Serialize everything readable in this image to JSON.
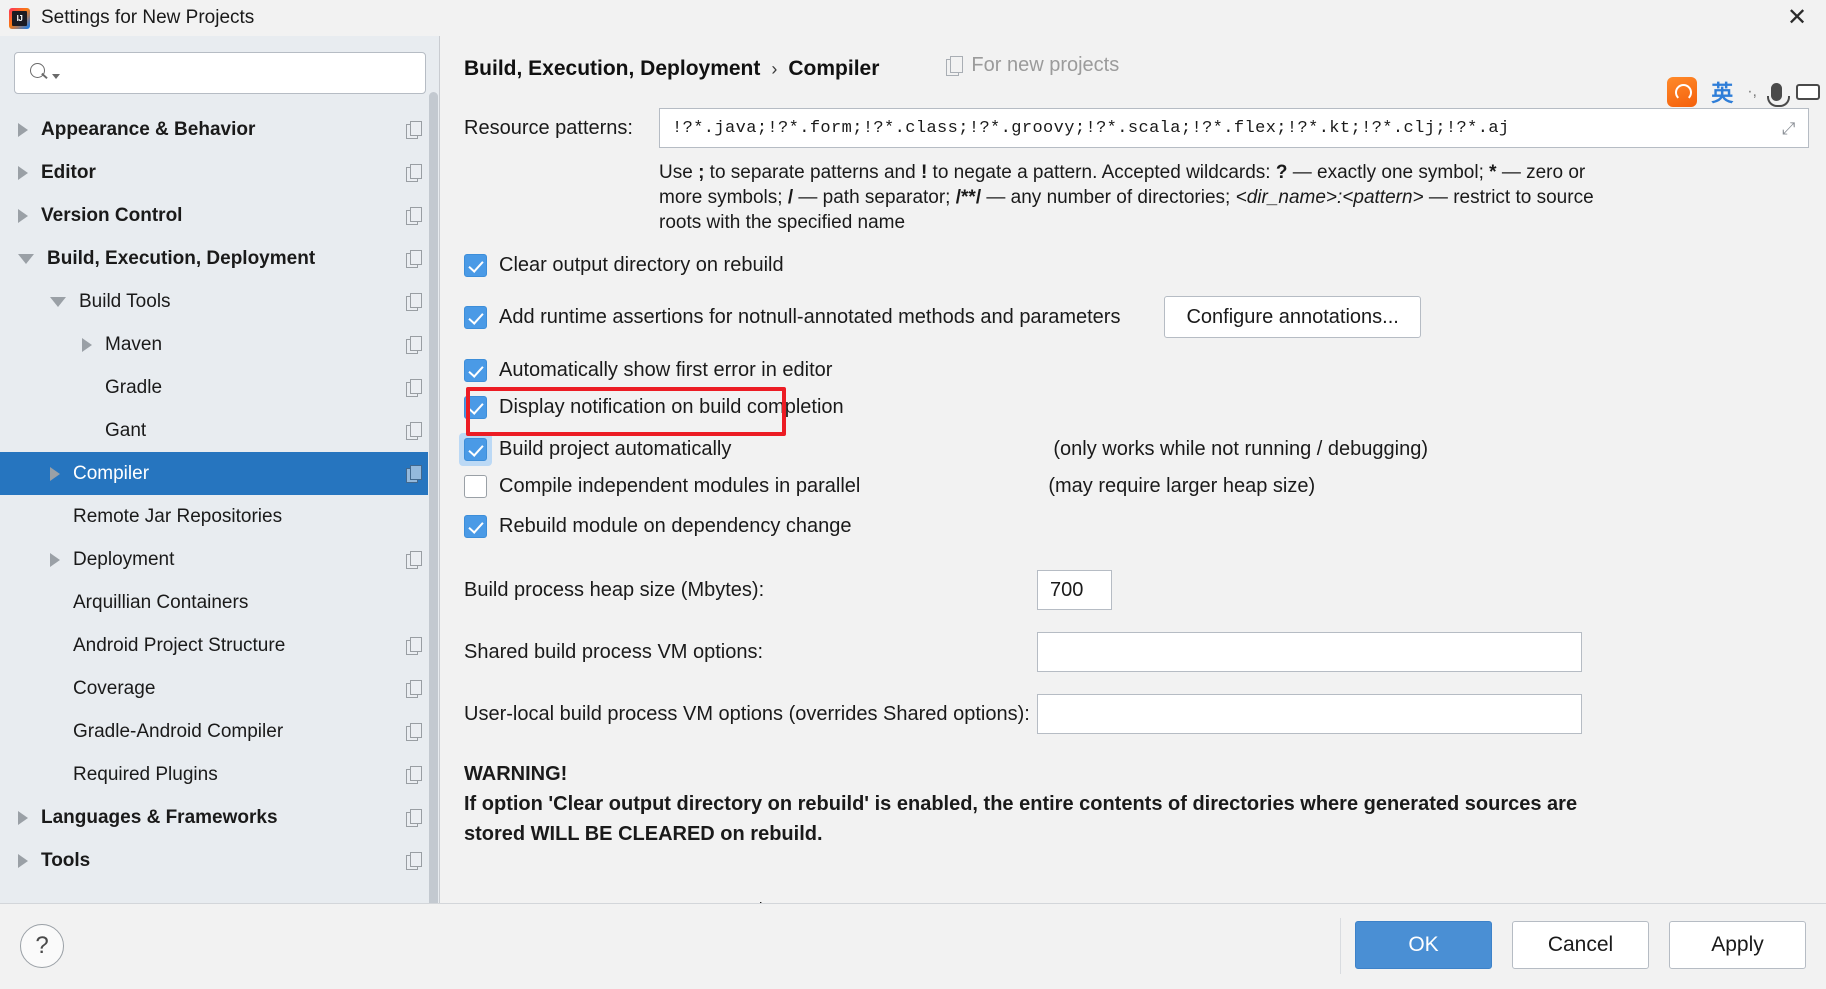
{
  "window": {
    "title": "Settings for New Projects",
    "app_icon": "intellij-idea-logo",
    "close_label": "✕"
  },
  "search": {
    "placeholder": "",
    "value": "",
    "icon": "search-icon"
  },
  "sidebar": {
    "items": [
      {
        "label": "Appearance & Behavior",
        "arrow": "right",
        "indent": 0,
        "bold": true,
        "selected": false,
        "badge": true
      },
      {
        "label": "Editor",
        "arrow": "right",
        "indent": 0,
        "bold": true,
        "selected": false,
        "badge": true
      },
      {
        "label": "Version Control",
        "arrow": "right",
        "indent": 0,
        "bold": true,
        "selected": false,
        "badge": true
      },
      {
        "label": "Build, Execution, Deployment",
        "arrow": "down",
        "indent": 0,
        "bold": true,
        "selected": false,
        "badge": true
      },
      {
        "label": "Build Tools",
        "arrow": "down",
        "indent": 1,
        "bold": false,
        "selected": false,
        "badge": true
      },
      {
        "label": "Maven",
        "arrow": "right",
        "indent": 2,
        "bold": false,
        "selected": false,
        "badge": true
      },
      {
        "label": "Gradle",
        "arrow": "none",
        "indent": 2,
        "bold": false,
        "selected": false,
        "badge": true
      },
      {
        "label": "Gant",
        "arrow": "none",
        "indent": 2,
        "bold": false,
        "selected": false,
        "badge": true
      },
      {
        "label": "Compiler",
        "arrow": "right",
        "indent": 1,
        "bold": false,
        "selected": true,
        "badge": true
      },
      {
        "label": "Remote Jar Repositories",
        "arrow": "none",
        "indent": 1,
        "bold": false,
        "selected": false,
        "badge": false
      },
      {
        "label": "Deployment",
        "arrow": "right",
        "indent": 1,
        "bold": false,
        "selected": false,
        "badge": true
      },
      {
        "label": "Arquillian Containers",
        "arrow": "none",
        "indent": 1,
        "bold": false,
        "selected": false,
        "badge": false
      },
      {
        "label": "Android Project Structure",
        "arrow": "none",
        "indent": 1,
        "bold": false,
        "selected": false,
        "badge": true
      },
      {
        "label": "Coverage",
        "arrow": "none",
        "indent": 1,
        "bold": false,
        "selected": false,
        "badge": true
      },
      {
        "label": "Gradle-Android Compiler",
        "arrow": "none",
        "indent": 1,
        "bold": false,
        "selected": false,
        "badge": true
      },
      {
        "label": "Required Plugins",
        "arrow": "none",
        "indent": 1,
        "bold": false,
        "selected": false,
        "badge": true
      },
      {
        "label": "Languages & Frameworks",
        "arrow": "right",
        "indent": 0,
        "bold": true,
        "selected": false,
        "badge": true
      },
      {
        "label": "Tools",
        "arrow": "right",
        "indent": 0,
        "bold": true,
        "selected": false,
        "badge": true
      }
    ]
  },
  "breadcrumb": {
    "root": "Build, Execution, Deployment",
    "separator": "›",
    "leaf": "Compiler",
    "scope_note": "For new projects",
    "scope_icon": "copy-icon"
  },
  "ime": {
    "logo": "sogou-logo",
    "lang_label": "英",
    "dot_label": "·,",
    "mic_icon": "microphone-icon",
    "keyboard_icon": "keyboard-icon"
  },
  "main": {
    "resource_patterns_label": "Resource patterns:",
    "resource_patterns_value": "!?*.java;!?*.form;!?*.class;!?*.groovy;!?*.scala;!?*.flex;!?*.kt;!?*.clj;!?*.aj",
    "expand_icon": "expand-arrows-icon",
    "help_line_1a": "Use ",
    "help_line_1b": ";",
    "help_line_1c": " to separate patterns and ",
    "help_line_1d": "!",
    "help_line_1e": " to negate a pattern. Accepted wildcards: ",
    "help_line_1f": "?",
    "help_line_1g": " — exactly one symbol; ",
    "help_line_1h": "*",
    "help_line_1i": " — zero or",
    "help_line_2a": "more symbols; ",
    "help_line_2b": "/",
    "help_line_2c": " — path separator; ",
    "help_line_2d": "/**/",
    "help_line_2e": " — any number of directories; ",
    "help_line_2f": "<dir_name>:<pattern>",
    "help_line_2g": " — restrict to",
    "help_line_3": "source roots with the specified name",
    "checkboxes": [
      {
        "label": "Clear output directory on rebuild",
        "checked": true,
        "note": ""
      },
      {
        "label": "Add runtime assertions for notnull-annotated methods and parameters",
        "checked": true,
        "note": ""
      },
      {
        "label": "Automatically show first error in editor",
        "checked": true,
        "note": ""
      },
      {
        "label": "Display notification on build completion",
        "checked": true,
        "note": ""
      },
      {
        "label": "Build project automatically",
        "checked": true,
        "note": "(only works while not running / debugging)"
      },
      {
        "label": "Compile independent modules in parallel",
        "checked": false,
        "note": "(may require larger heap size)"
      },
      {
        "label": "Rebuild module on dependency change",
        "checked": true,
        "note": ""
      }
    ],
    "configure_annotations_button": "Configure annotations...",
    "heap_label": "Build process heap size (Mbytes):",
    "heap_value": "700",
    "shared_vm_label": "Shared build process VM options:",
    "shared_vm_value": "",
    "user_vm_label": "User-local build process VM options (overrides Shared options):",
    "user_vm_value": "",
    "warning_title": "WARNING!",
    "warning_line_1": "If option 'Clear output directory on rebuild' is enabled, the entire contents of directories where generated sources are",
    "warning_line_2": "stored WILL BE CLEARED on rebuild."
  },
  "footer": {
    "help_label": "?",
    "ok_label": "OK",
    "cancel_label": "Cancel",
    "apply_label": "Apply"
  },
  "colors": {
    "selection_blue": "#2675bf",
    "checkbox_blue": "#4a9ae6",
    "primary_button": "#4a8fd4",
    "annotation_red": "#ec1c24",
    "sidebar_bg": "#e8ecf0"
  }
}
